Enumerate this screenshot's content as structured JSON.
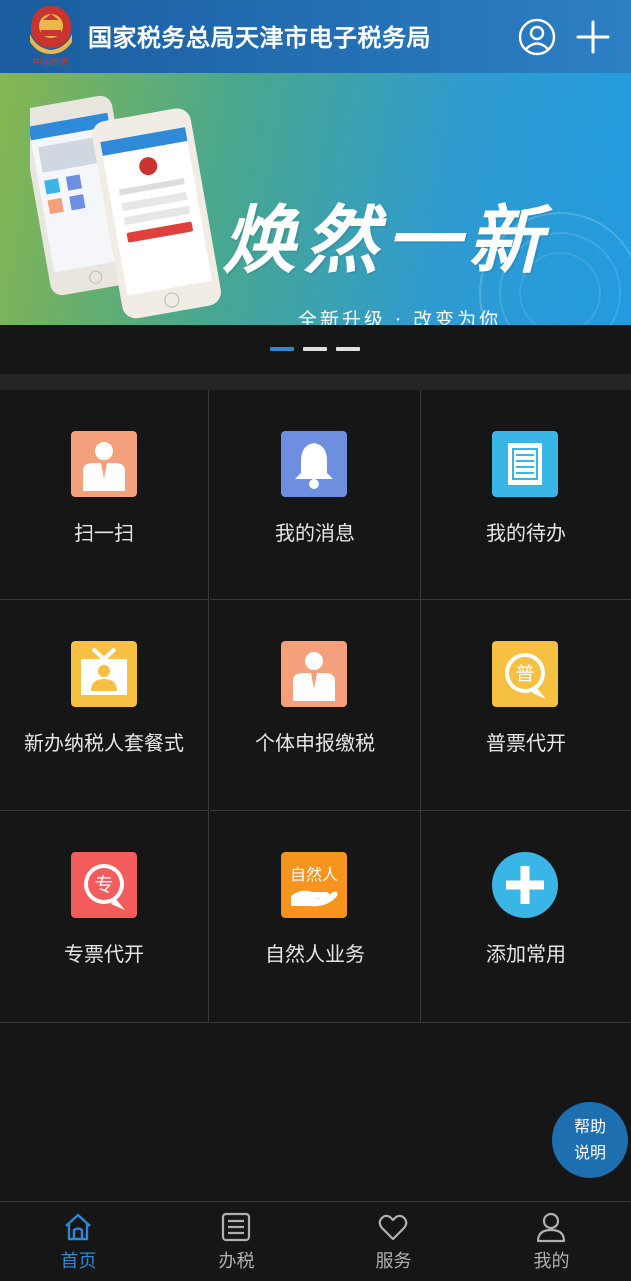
{
  "header": {
    "title": "国家税务总局天津市电子税务局",
    "user_icon": "user-circle-icon",
    "add_icon": "plus-icon",
    "emblem_caption": "中国税务"
  },
  "banner": {
    "slogan": "焕然一新",
    "subtitle": "全新升级 · 改变为你",
    "dots": 3,
    "active_dot": 0
  },
  "grid": [
    {
      "label": "扫一扫",
      "icon": "person-icon",
      "color": "#f4a07c"
    },
    {
      "label": "我的消息",
      "icon": "bell-icon",
      "color": "#6e8ee0"
    },
    {
      "label": "我的待办",
      "icon": "list-icon",
      "color": "#3ab6e6"
    },
    {
      "label": "新办纳税人套餐式",
      "icon": "gift-person-icon",
      "color": "#f6c043"
    },
    {
      "label": "个体申报缴税",
      "icon": "person-icon",
      "color": "#f4a07c"
    },
    {
      "label": "普票代开",
      "icon": "pu-invoice-icon",
      "color": "#f6c043"
    },
    {
      "label": "专票代开",
      "icon": "zhuan-invoice-icon",
      "color": "#f25c5c"
    },
    {
      "label": "自然人业务",
      "icon": "natural-person-icon",
      "color": "#f7941d"
    },
    {
      "label": "添加常用",
      "icon": "add-circle-icon",
      "color": "#3ab6e6"
    }
  ],
  "help": {
    "line1": "帮助",
    "line2": "说明"
  },
  "tabs": [
    {
      "label": "首页",
      "icon": "home-icon",
      "active": true
    },
    {
      "label": "办税",
      "icon": "document-icon",
      "active": false
    },
    {
      "label": "服务",
      "icon": "heart-icon",
      "active": false
    },
    {
      "label": "我的",
      "icon": "user-icon",
      "active": false
    }
  ],
  "colors": {
    "accent": "#2e86d6",
    "tab_inactive": "#b0b0b0",
    "header": "#2a78bd"
  }
}
